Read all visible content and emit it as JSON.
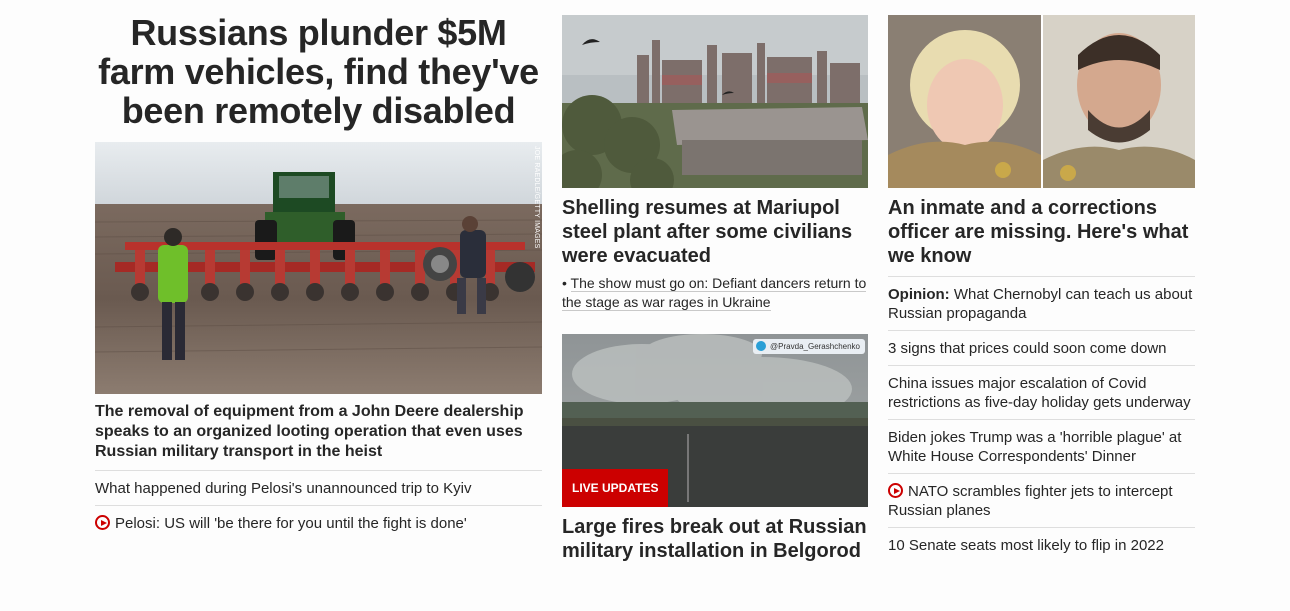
{
  "lead": {
    "headline": "Russians plunder $5M farm vehicles, find they've been remotely disabled",
    "photo_credit": "JOE RAEDLE/GETTY IMAGES",
    "summary": "The removal of equipment from a John Deere dealership speaks to an organized looting operation that even uses Russian military transport in the heist",
    "links": [
      {
        "text": "What happened during Pelosi's unannounced trip to Kyiv",
        "icon": null
      },
      {
        "text": "Pelosi: US will 'be there for you until the fight is done'",
        "icon": "play-circle-icon"
      }
    ]
  },
  "middle": {
    "card1": {
      "title": "Shelling resumes at Mariupol steel plant after some civilians were evacuated",
      "bullet": "• ",
      "bullet_link": "The show must go on: Defiant dancers return to the stage as war rages in Ukraine"
    },
    "card2": {
      "badge": "LIVE UPDATES",
      "source_tag": "@Pravda_Gerashchenko",
      "title": "Large fires break out at Russian military installation in Belgorod"
    }
  },
  "right": {
    "card_title": "An inmate and a corrections officer are missing. Here's what we know",
    "links": [
      {
        "prefix": "Opinion:",
        "text": " What Chernobyl can teach us about Russian propaganda",
        "icon": null
      },
      {
        "prefix": "",
        "text": "3 signs that prices could soon come down",
        "icon": null
      },
      {
        "prefix": "",
        "text": "China issues major escalation of Covid restrictions as five-day holiday gets underway",
        "icon": null
      },
      {
        "prefix": "",
        "text": "Biden jokes Trump was a 'horrible plague' at White House Correspondents' Dinner",
        "icon": null
      },
      {
        "prefix": "",
        "text": "NATO scrambles fighter jets to intercept Russian planes",
        "icon": "play-circle-icon"
      },
      {
        "prefix": "",
        "text": "10 Senate seats most likely to flip in 2022",
        "icon": null
      }
    ]
  },
  "colors": {
    "accent_red": "#cc0000",
    "text": "#262626",
    "rule": "#dedede"
  }
}
